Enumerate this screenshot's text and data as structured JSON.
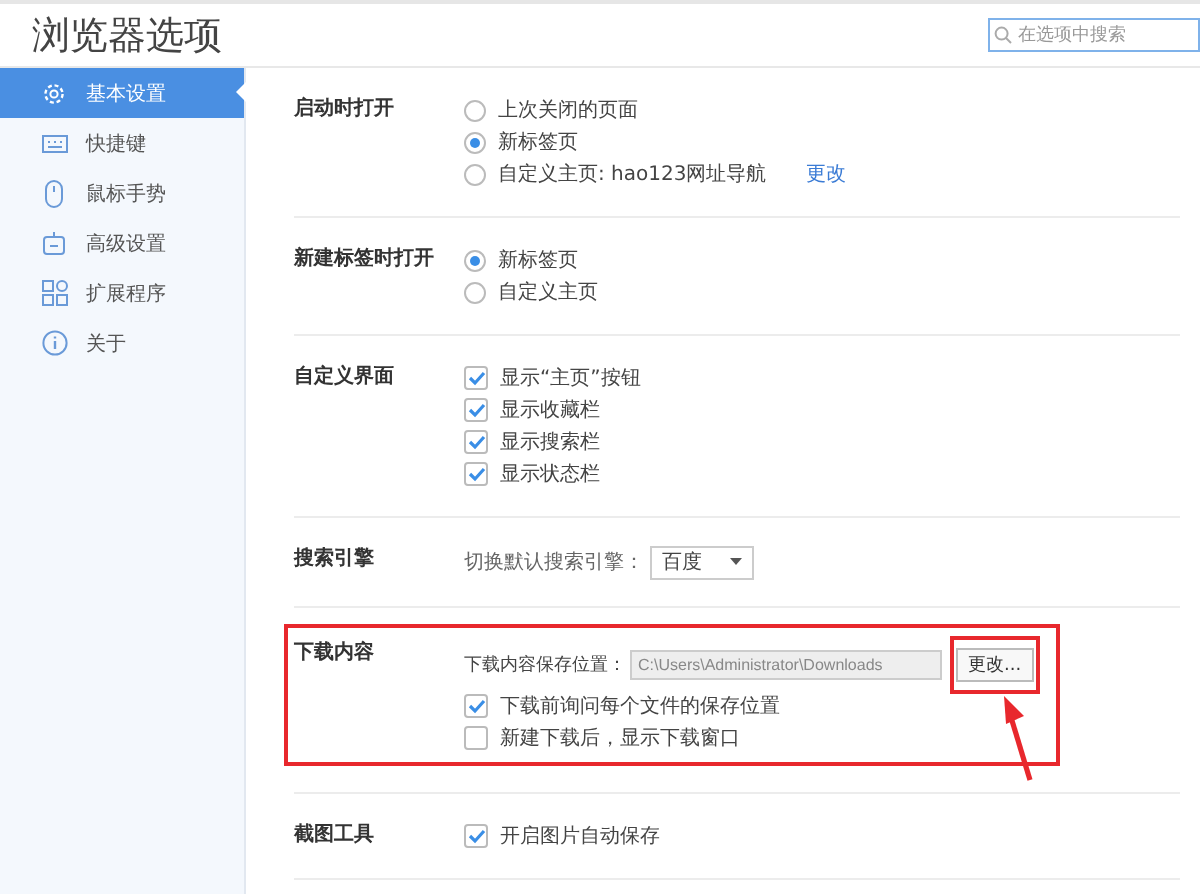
{
  "window": {
    "title": "浏览器选项"
  },
  "search": {
    "placeholder": "在选项中搜索"
  },
  "sidebar": {
    "items": [
      {
        "label": "基本设置",
        "selected": true
      },
      {
        "label": "快捷键",
        "selected": false
      },
      {
        "label": "鼠标手势",
        "selected": false
      },
      {
        "label": "高级设置",
        "selected": false
      },
      {
        "label": "扩展程序",
        "selected": false
      },
      {
        "label": "关于",
        "selected": false
      }
    ]
  },
  "sections": [
    {
      "kind": "radio",
      "label": "启动时打开",
      "options": [
        {
          "label": "上次关闭的页面",
          "selected": false
        },
        {
          "label": "新标签页",
          "selected": true
        },
        {
          "label": "自定义主页: hao123网址导航",
          "selected": false,
          "link": "更改"
        }
      ]
    },
    {
      "kind": "radio",
      "label": "新建标签时打开",
      "options": [
        {
          "label": "新标签页",
          "selected": true
        },
        {
          "label": "自定义主页",
          "selected": false
        }
      ]
    },
    {
      "kind": "checkbox",
      "label": "自定义界面",
      "options": [
        {
          "label": "显示“主页”按钮",
          "checked": true
        },
        {
          "label": "显示收藏栏",
          "checked": true
        },
        {
          "label": "显示搜索栏",
          "checked": true
        },
        {
          "label": "显示状态栏",
          "checked": true
        }
      ]
    },
    {
      "kind": "select",
      "label": "搜索引擎",
      "prompt": "切换默认搜索引擎：",
      "value": "百度"
    },
    {
      "kind": "path",
      "label": "下载内容",
      "highlighted": true,
      "path_label": "下载内容保存位置：",
      "path": "C:\\Users\\Administrator\\Downloads",
      "button": {
        "label": "更改...",
        "highlighted": true
      },
      "options": [
        {
          "label": "下载前询问每个文件的保存位置",
          "checked": true
        },
        {
          "label": "新建下载后，显示下载窗口",
          "checked": false
        }
      ]
    },
    {
      "kind": "checkbox",
      "label": "截图工具",
      "options": [
        {
          "label": "开启图片自动保存",
          "checked": true
        }
      ]
    }
  ]
}
